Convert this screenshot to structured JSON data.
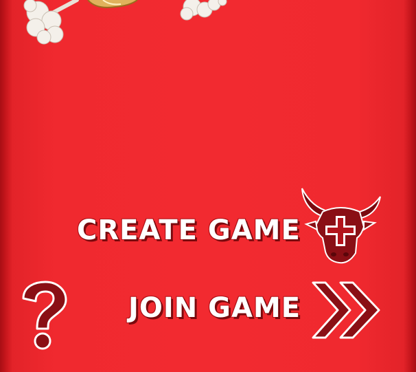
{
  "menu": {
    "create_game_label": "CREATE GAME",
    "join_game_label": "JOIN GAME",
    "help_glyph": "?"
  },
  "icons": {
    "create": "bull-head-plus-icon",
    "join": "double-chevron-right-icon",
    "help": "question-mark-icon",
    "decor": "smoke-puff-icon"
  },
  "colors": {
    "background": "#f22a30",
    "edge": "#a80e14",
    "text": "#ffffff",
    "icon_dark": "#8a0f15"
  }
}
